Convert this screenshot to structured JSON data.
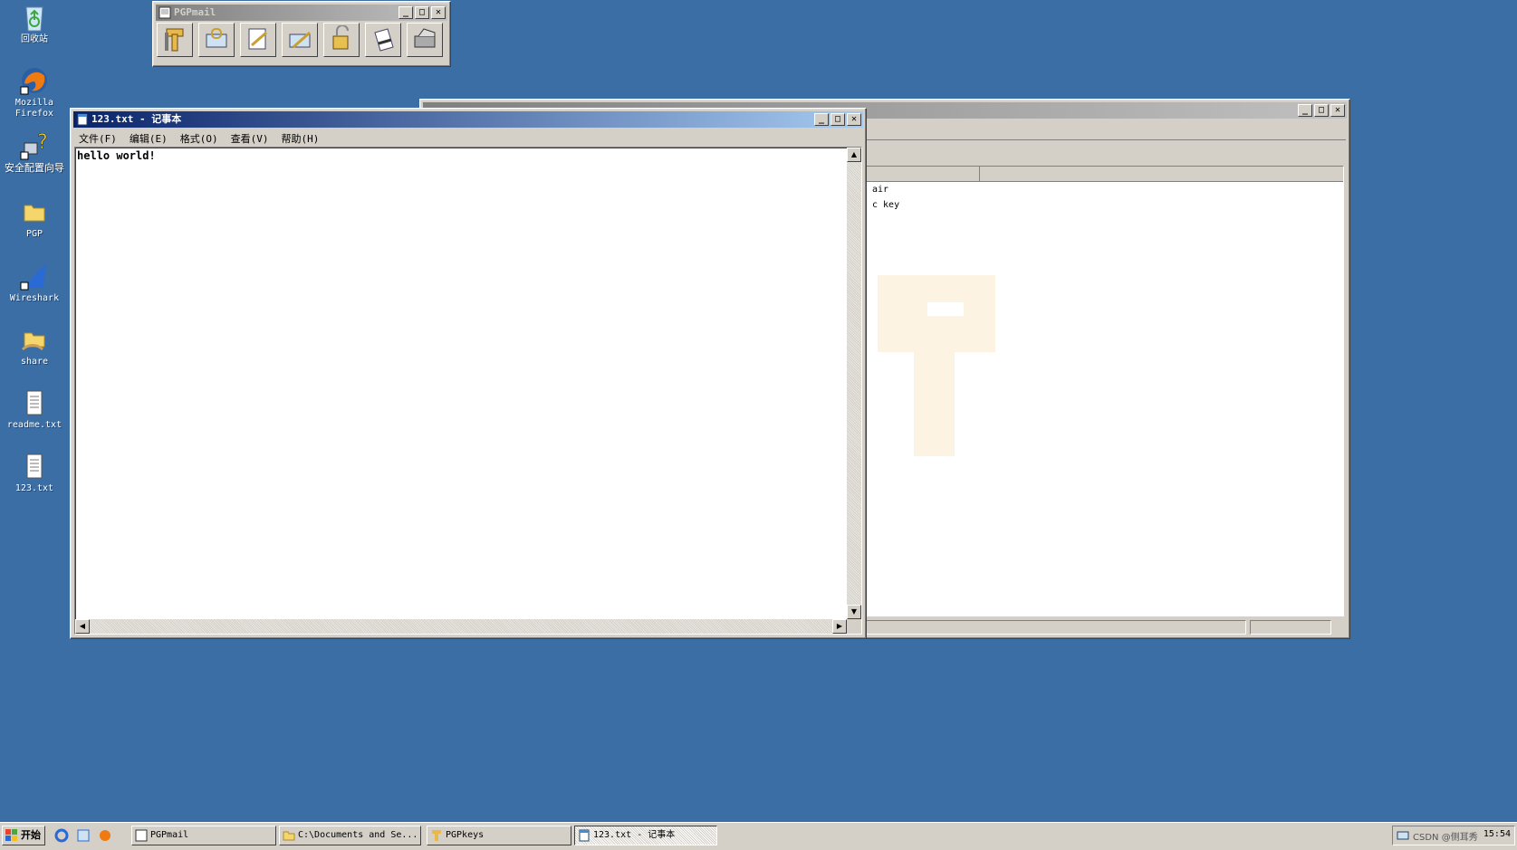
{
  "desktop": {
    "icons": [
      {
        "label": "回收站",
        "icon": "recycle-bin-icon"
      },
      {
        "label": "Mozilla Firefox",
        "icon": "firefox-icon"
      },
      {
        "label": "安全配置向导",
        "icon": "security-wizard-icon"
      },
      {
        "label": "PGP",
        "icon": "folder-icon"
      },
      {
        "label": "Wireshark",
        "icon": "wireshark-icon"
      },
      {
        "label": "share",
        "icon": "shared-folder-icon"
      },
      {
        "label": "readme.txt",
        "icon": "text-file-icon"
      },
      {
        "label": "123.txt",
        "icon": "text-file-icon"
      }
    ]
  },
  "pgpmail": {
    "title": "PGPmail",
    "tools": [
      "pgpkeys-icon",
      "encrypt-icon",
      "sign-icon",
      "encrypt-sign-icon",
      "decrypt-verify-icon",
      "wipe-icon",
      "freespace-wipe-icon"
    ]
  },
  "notepad": {
    "title": "123.txt - 记事本",
    "menu": [
      "文件(F)",
      "编辑(E)",
      "格式(O)",
      "查看(V)",
      "帮助(H)"
    ],
    "content": "hello world!"
  },
  "pgpkeys": {
    "rows": [
      "air",
      "c key"
    ]
  },
  "taskbar": {
    "start": "开始",
    "tasks": [
      "PGPmail",
      "C:\\Documents and Se...",
      "PGPkeys",
      "123.txt - 记事本"
    ],
    "clock": "15:54",
    "watermark": "CSDN @侧耳秀"
  },
  "colors": {
    "desktop": "#3a6ea5",
    "title_active": "#0a246a",
    "title_inactive": "#808080"
  }
}
